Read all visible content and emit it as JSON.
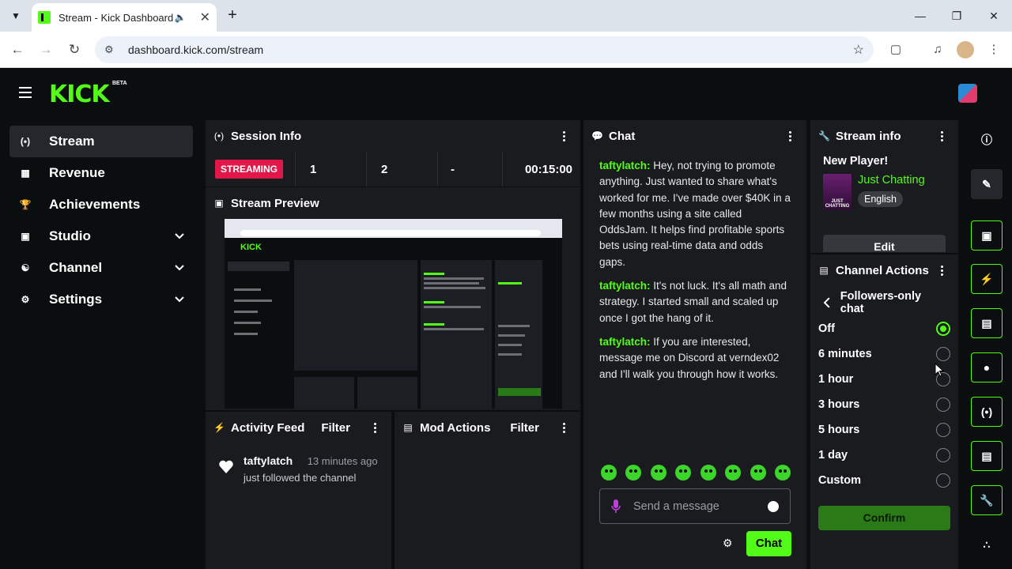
{
  "browser": {
    "tab_title": "Stream - Kick Dashboard",
    "url": "dashboard.kick.com/stream"
  },
  "header": {
    "logo": "KICK",
    "logo_badge": "BETA"
  },
  "sidebar": {
    "items": [
      {
        "label": "Stream",
        "icon": "broadcast-icon"
      },
      {
        "label": "Revenue",
        "icon": "bar-chart-icon"
      },
      {
        "label": "Achievements",
        "icon": "trophy-icon"
      },
      {
        "label": "Studio",
        "icon": "studio-icon"
      },
      {
        "label": "Channel",
        "icon": "channel-icon"
      },
      {
        "label": "Settings",
        "icon": "gear-icon"
      }
    ]
  },
  "session_info": {
    "title": "Session Info",
    "status_badge": "STREAMING",
    "stat1": "1",
    "stat2": "2",
    "stat3": "-",
    "duration": "00:15:00"
  },
  "stream_preview": {
    "title": "Stream Preview"
  },
  "activity_feed": {
    "title": "Activity Feed",
    "filter": "Filter",
    "items": [
      {
        "user": "taftylatch",
        "time": "13 minutes ago",
        "desc": "just followed the channel"
      }
    ]
  },
  "mod_actions": {
    "title": "Mod Actions",
    "filter": "Filter"
  },
  "chat": {
    "title": "Chat",
    "messages": [
      {
        "user": "taftylatch:",
        "text": "Hey, not trying to promote anything. Just wanted to share what's worked for me. I've made over $40K in a few months using a site called OddsJam. It helps find profitable sports bets using real-time data and odds gaps."
      },
      {
        "user": "taftylatch:",
        "text": "It's not luck. It's all math and strategy. I started small and scaled up once I got the hang of it."
      },
      {
        "user": "taftylatch:",
        "text": "If you are interested, message me on Discord at verndex02 and I'll walk you through how it works."
      }
    ],
    "input_placeholder": "Send a message",
    "send_label": "Chat"
  },
  "stream_info": {
    "title": "Stream info",
    "stream_title": "New Player!",
    "category": "Just Chatting",
    "thumb_text": "JUST CHATTING",
    "language": "English",
    "edit_label": "Edit"
  },
  "channel_actions": {
    "title": "Channel Actions",
    "submenu": "Followers-only chat",
    "options": [
      {
        "label": "Off",
        "selected": true
      },
      {
        "label": "6 minutes",
        "selected": false
      },
      {
        "label": "1 hour",
        "selected": false
      },
      {
        "label": "3 hours",
        "selected": false
      },
      {
        "label": "5 hours",
        "selected": false
      },
      {
        "label": "1 day",
        "selected": false
      },
      {
        "label": "Custom",
        "selected": false
      }
    ],
    "confirm_label": "Confirm"
  },
  "colors": {
    "accent": "#53fc18",
    "streaming_badge": "#e1174a",
    "panel_bg": "#191b1f",
    "page_bg": "#0b0e0f"
  }
}
